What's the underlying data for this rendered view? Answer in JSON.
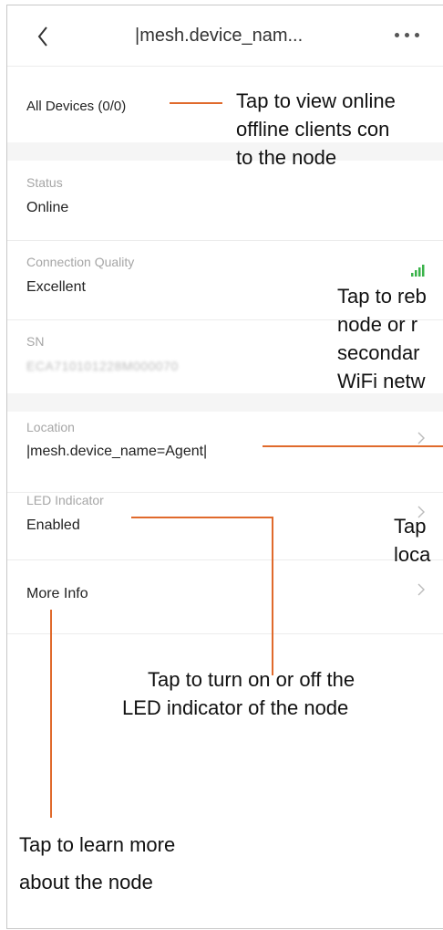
{
  "header": {
    "title": "|mesh.device_nam..."
  },
  "all_devices": {
    "label": "All Devices (0/0)"
  },
  "status": {
    "label": "Status",
    "value": "Online"
  },
  "connection_quality": {
    "label": "Connection Quality",
    "value": "Excellent",
    "signal_color": "#3ab34a"
  },
  "sn": {
    "label": "SN",
    "value": "ECA710101228M000070"
  },
  "location": {
    "label": "Location",
    "value": "|mesh.device_name=Agent|"
  },
  "led": {
    "label": "LED Indicator",
    "value": "Enabled"
  },
  "more_info": {
    "label": "More Info"
  },
  "annotations": {
    "all_devices_line1": "Tap to view online",
    "all_devices_line2": "offline clients con",
    "all_devices_line3": "to the node",
    "reboot_line1": "Tap to reb",
    "reboot_line2": "node or r",
    "reboot_line3": "secondar",
    "reboot_line4": "WiFi netw",
    "location_line1": "Tap",
    "location_line2": "loca",
    "led_line1": "Tap to turn on or off the",
    "led_line2": "LED indicator of the node",
    "more_line1": "Tap to learn more",
    "more_line2": "about the node"
  },
  "colors": {
    "callout_line": "#e06a2c",
    "accent_green": "#3ab34a"
  }
}
